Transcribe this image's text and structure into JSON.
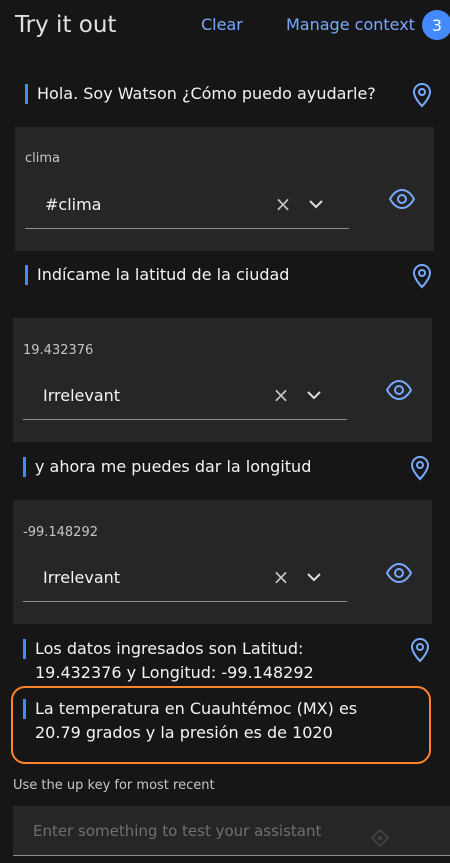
{
  "header": {
    "title": "Try it out",
    "clear_label": "Clear",
    "manage_context_label": "Manage context",
    "badge_count": "3"
  },
  "conversation": [
    {
      "type": "bot",
      "text": "Hola. Soy Watson ¿Cómo puedo ayudarle?"
    },
    {
      "type": "user",
      "input": "clima",
      "intent": "#clima"
    },
    {
      "type": "bot",
      "text": "Indícame la latitud de la ciudad"
    },
    {
      "type": "user",
      "input": "19.432376",
      "intent": "Irrelevant"
    },
    {
      "type": "bot",
      "text": "y ahora me puedes dar la longitud"
    },
    {
      "type": "user",
      "input": "-99.148292",
      "intent": "Irrelevant"
    },
    {
      "type": "bot",
      "line1": "Los datos ingresados son Latitud:",
      "line2": "19.432376 y Longitud: -99.148292"
    },
    {
      "type": "bot",
      "line1": "La temperatura en Cuauhtémoc (MX) es",
      "line2": "20.79 grados y la presión es de 1020"
    }
  ],
  "footer": {
    "hint": "Use the up key for most recent",
    "input_placeholder": "Enter something to test your assistant"
  },
  "colors": {
    "background": "#161616",
    "panel": "#262626",
    "accent": "#4589ff",
    "link": "#78a9ff",
    "highlight": "#ff832b"
  }
}
